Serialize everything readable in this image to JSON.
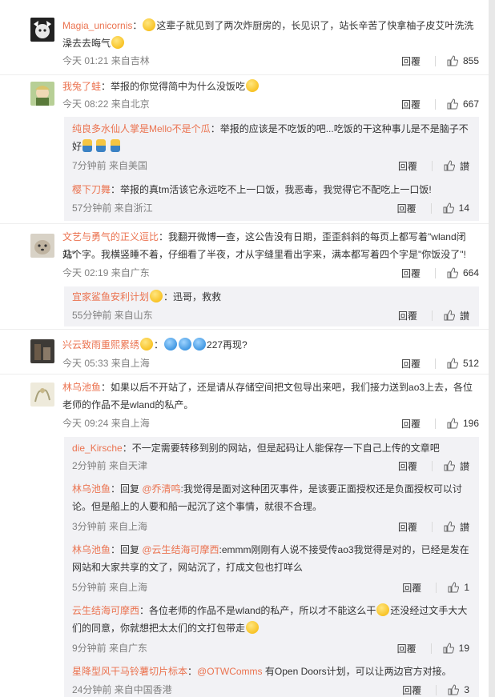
{
  "comments": [
    {
      "user": "Magia_unicornis",
      "text_a": "这辈子就见到了两次炸厨房的，长见识了，站长辛苦了快拿柚子皮艾叶洗洗",
      "text_b": "澡去去晦气",
      "time": "今天 01:21 来自吉林",
      "reply_label": "回覆",
      "likes": "855",
      "avatar_color": "#2b2b2b",
      "replies": []
    },
    {
      "user": "我兔了蛙",
      "text_a": "：举报的你觉得简中为什么没饭吃",
      "time": "今天 08:22 来自北京",
      "reply_label": "回覆",
      "likes": "667",
      "avatar_color": "#9ab87a",
      "replies": [
        {
          "user": "纯良多水仙人掌是Mello不是个瓜",
          "text_a": "：举报的应该是不吃饭的吧...吃饭的干这种事儿是不是脑子不",
          "text_b": "好",
          "time": "7分钟前 来自美国",
          "reply_label": "回覆",
          "likes": "讃"
        },
        {
          "user": "樱下刀舞",
          "text_a": "：举报的真tm活该它永远吃不上一口饭，我恶毒，我觉得它不配吃上一口饭!",
          "time": "57分钟前 来自浙江",
          "reply_label": "回覆",
          "likes": "14"
        }
      ]
    },
    {
      "user": "文艺与勇气的正义逗比",
      "text_a": "：我翻开微博一查，这公告没有日期，歪歪斜斜的每页上都写着\"wland闭站\"",
      "text_b": "几个字。我横竖睡不着，仔细看了半夜，才从字缝里看出字来，满本都写着四个字是\"你饭没了\"!",
      "time": "今天 02:19 来自广东",
      "reply_label": "回覆",
      "likes": "664",
      "avatar_color": "#c8c0b4",
      "replies": [
        {
          "user": "宜家鲨鱼安利计划",
          "text_a": "：迅哥，救救",
          "time": "55分钟前 来自山东",
          "reply_label": "回覆",
          "likes": "讃"
        }
      ]
    },
    {
      "user": "兴云致雨重熙累绣",
      "text_a": "：",
      "text_b": "227再现?",
      "time": "今天 05:33 来自上海",
      "reply_label": "回覆",
      "likes": "512",
      "avatar_color": "#3d3a36",
      "replies": []
    },
    {
      "user": "林乌池鱼",
      "text_a": "：如果以后不开站了，还是请从存储空间把文包导出来吧，我们接力送到ao3上去，各位",
      "text_b": "老师的作品不是wland的私产。",
      "time": "今天 09:24 来自上海",
      "reply_label": "回覆",
      "likes": "196",
      "avatar_color": "#e9e4cf",
      "replies": [
        {
          "user": "die_Kirsche",
          "text_a": "：不一定需要转移到别的网站，但是起码让人能保存一下自己上传的文章吧",
          "time": "2分钟前 来自天津",
          "reply_label": "回覆",
          "likes": "讃"
        },
        {
          "user": "林乌池鱼",
          "text_a": "：回复 ",
          "mention": "@乔清鸣",
          "text_m": ":我觉得是面对这种团灭事件，是该要正面授权还是负面授权可以讨",
          "text_b": "论。但是船上的人要和船一起沉了这个事情，就很不合理。",
          "time": "3分钟前 来自上海",
          "reply_label": "回覆",
          "likes": "讃"
        },
        {
          "user": "林乌池鱼",
          "text_a": "：回复 ",
          "mention": "@云生结海可摩西",
          "text_m": ":emmm刚刚有人说不接受传ao3我觉得是对的，已经是发在",
          "text_b": "网站和大家共享的文了，网站沉了，打成文包也打咩么",
          "time": "5分钟前 来自上海",
          "reply_label": "回覆",
          "likes": "1"
        },
        {
          "user": "云生结海可摩西",
          "text_a": "：各位老师的作品不是wland的私产，所以才不能这么干",
          "text_m": "还没经过文手大大",
          "text_b": "们的同意，你就想把太太们的文打包带走",
          "time": "9分钟前 来自广东",
          "reply_label": "回覆",
          "likes": "19"
        },
        {
          "user": "星降型风干马铃薯切片标本",
          "text_a": "：",
          "mention": "@OTWComms",
          "text_m": " 有Open Doors计划，可以让两边官方对接。",
          "time": "24分钟前 来自中国香港",
          "reply_label": "回覆",
          "likes": "3"
        }
      ]
    }
  ],
  "colors": {
    "nick": "#eb7350",
    "meta": "#808080",
    "reply_bg": "#f2f2f5"
  }
}
